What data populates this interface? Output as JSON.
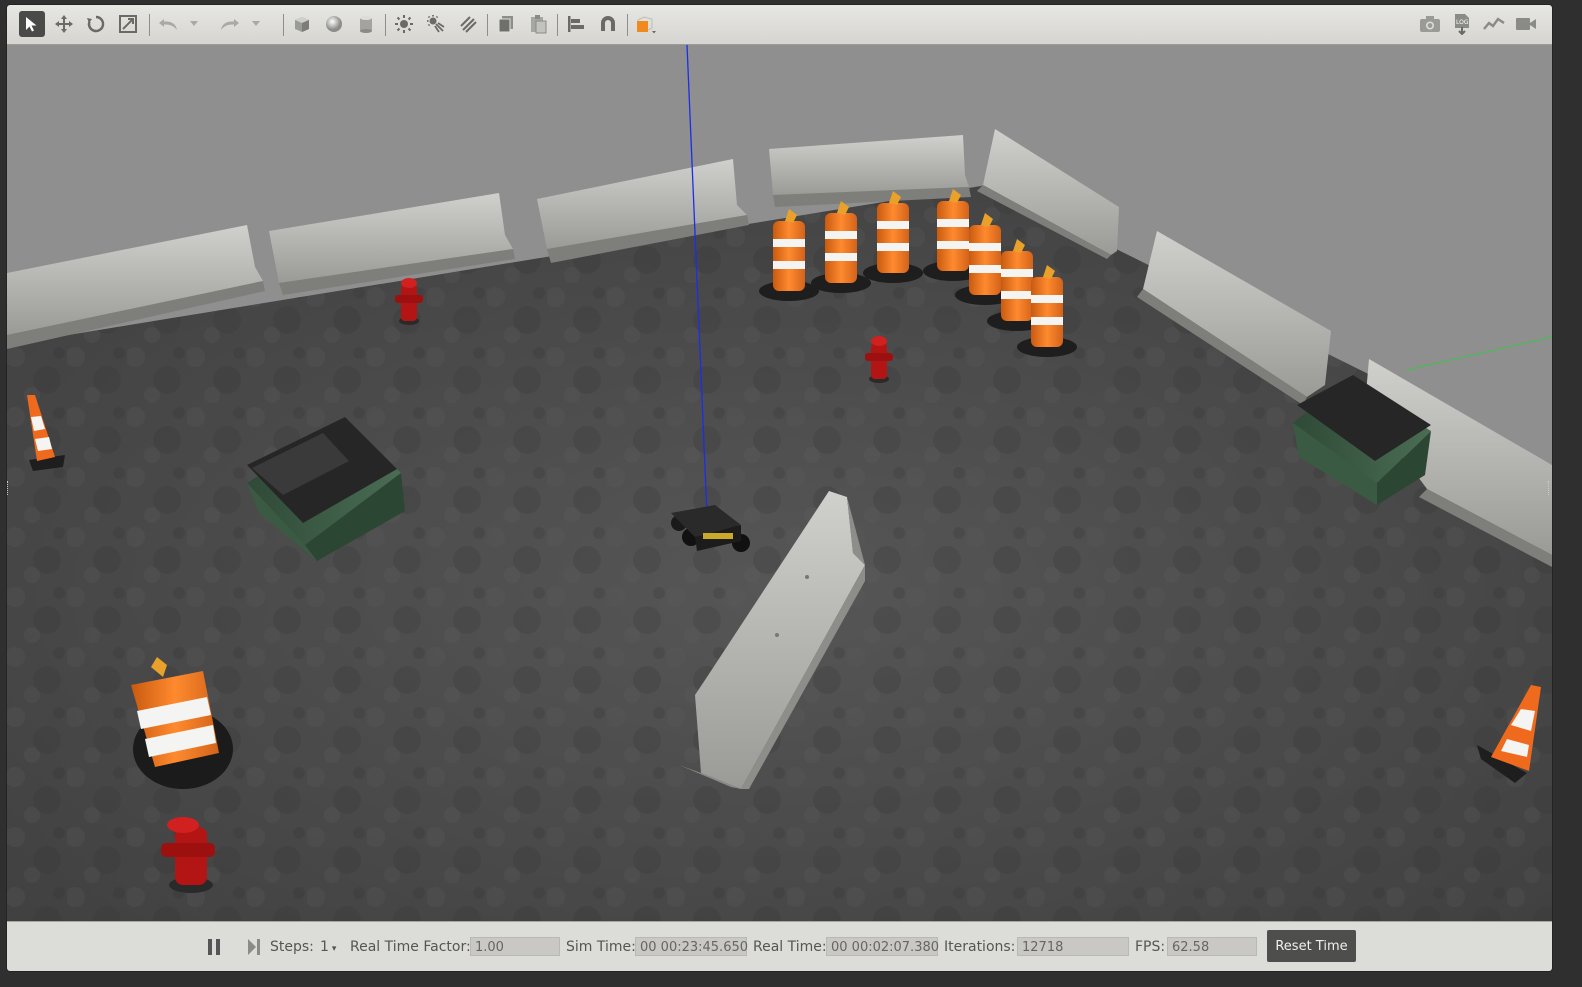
{
  "toolbar": {
    "left_tools": [
      {
        "name": "select-mode-icon",
        "active": true
      },
      {
        "name": "translate-mode-icon"
      },
      {
        "name": "rotate-mode-icon"
      },
      {
        "name": "scale-mode-icon"
      },
      {
        "name": "undo-icon"
      },
      {
        "name": "undo-dropdown-icon"
      },
      {
        "name": "redo-icon"
      },
      {
        "name": "redo-dropdown-icon"
      },
      {
        "name": "box-shape-icon"
      },
      {
        "name": "sphere-shape-icon"
      },
      {
        "name": "cylinder-shape-icon"
      },
      {
        "name": "point-light-icon"
      },
      {
        "name": "spot-light-icon"
      },
      {
        "name": "directional-light-icon"
      },
      {
        "name": "copy-icon"
      },
      {
        "name": "paste-icon"
      },
      {
        "name": "align-icon"
      },
      {
        "name": "snap-icon"
      },
      {
        "name": "view-angle-icon"
      }
    ],
    "right_tools": [
      {
        "name": "screenshot-icon"
      },
      {
        "name": "log-icon",
        "text": "LOG"
      },
      {
        "name": "plot-icon"
      },
      {
        "name": "record-video-icon"
      }
    ]
  },
  "bottom_bar": {
    "steps_label": "Steps:",
    "steps_value": "1",
    "rtf_label": "Real Time Factor:",
    "rtf_value": "1.00",
    "sim_time_label": "Sim Time:",
    "sim_time_value": "00 00:23:45.650",
    "real_time_label": "Real Time:",
    "real_time_value": "00 00:02:07.380",
    "iterations_label": "Iterations:",
    "iterations_value": "12718",
    "fps_label": "FPS:",
    "fps_value": "62.58",
    "reset_label": "Reset Time"
  },
  "colors": {
    "sky": "#8e8e8e",
    "asphalt": "#4a4a4a",
    "concrete": "#b5b5b2",
    "cone_orange": "#f2741c",
    "dumpster_green": "#3a5a44",
    "hydrant_red": "#b31414",
    "toolbar_bg": "#dcdcd8",
    "accent_orange": "#f08a1e"
  }
}
